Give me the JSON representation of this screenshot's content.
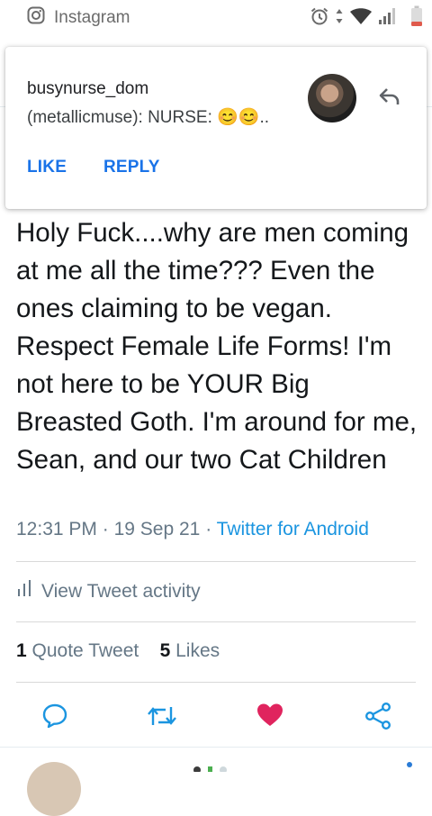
{
  "status_bar": {
    "app_name": "Instagram",
    "icons": [
      "instagram-icon",
      "alarm-icon",
      "data-arrows-icon",
      "wifi-icon",
      "signal-icon",
      "battery-low-icon"
    ],
    "battery_color": "#e05a4c"
  },
  "notification": {
    "sender": "busynurse_dom",
    "message": "(metallicmuse): NURSE: 😊😊..",
    "actions": {
      "like": "LIKE",
      "reply": "REPLY"
    },
    "accent": "#1a73e8"
  },
  "tweet": {
    "text": "Holy Fuck....why are men coming at me all the time??? Even the ones claiming to be vegan. Respect Female Life Forms! I'm not here to be YOUR Big Breasted Goth. I'm around for me, Sean, and our two Cat Children",
    "time": "12:31 PM",
    "sep1": "·",
    "date": "19 Sep 21",
    "sep2": "·",
    "source": "Twitter for Android",
    "activity_label": "View Tweet activity",
    "quote_count": "1",
    "quote_label": "Quote Tweet",
    "like_count": "5",
    "like_label": "Likes"
  },
  "actions": {
    "icons": [
      "reply-icon",
      "retweet-icon",
      "like-heart-icon",
      "share-icon"
    ],
    "liked_color": "#e0245e",
    "icon_color": "#1b95e0"
  }
}
